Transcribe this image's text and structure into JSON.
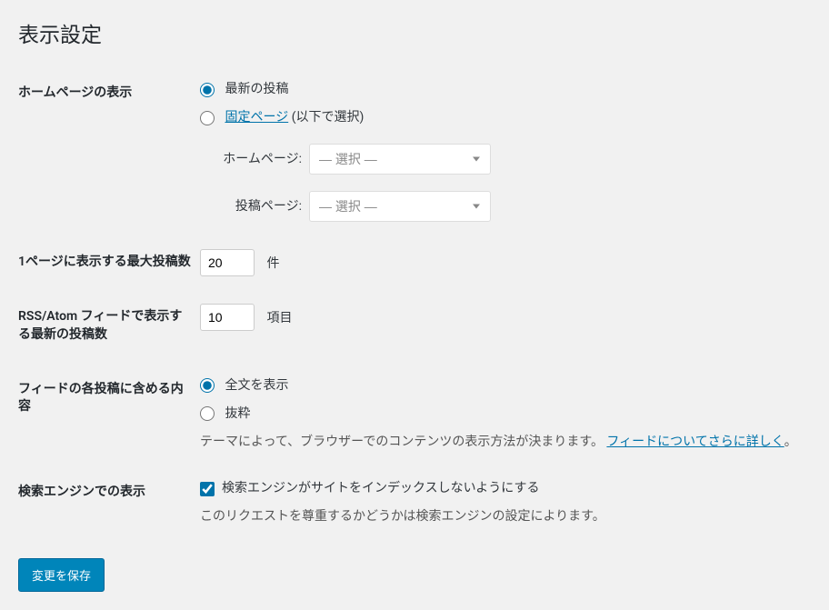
{
  "page_title": "表示設定",
  "homepage": {
    "label": "ホームページの表示",
    "option_latest": "最新の投稿",
    "option_static_link": "固定ページ",
    "option_static_suffix": " (以下で選択)",
    "homepage_select_label": "ホームページ:",
    "posts_page_select_label": "投稿ページ:",
    "select_placeholder": "— 選択 —"
  },
  "posts_per_page": {
    "label": "1ページに表示する最大投稿数",
    "value": "20",
    "unit": "件"
  },
  "feed_items": {
    "label": "RSS/Atom フィードで表示する最新の投稿数",
    "value": "10",
    "unit": "項目"
  },
  "feed_content": {
    "label": "フィードの各投稿に含める内容",
    "option_full": "全文を表示",
    "option_excerpt": "抜粋",
    "description_prefix": "テーマによって、ブラウザーでのコンテンツの表示方法が決まります。 ",
    "description_link": "フィードについてさらに詳しく",
    "description_suffix": "。"
  },
  "search_engine": {
    "label": "検索エンジンでの表示",
    "checkbox_label": "検索エンジンがサイトをインデックスしないようにする",
    "description": "このリクエストを尊重するかどうかは検索エンジンの設定によります。"
  },
  "submit_label": "変更を保存"
}
